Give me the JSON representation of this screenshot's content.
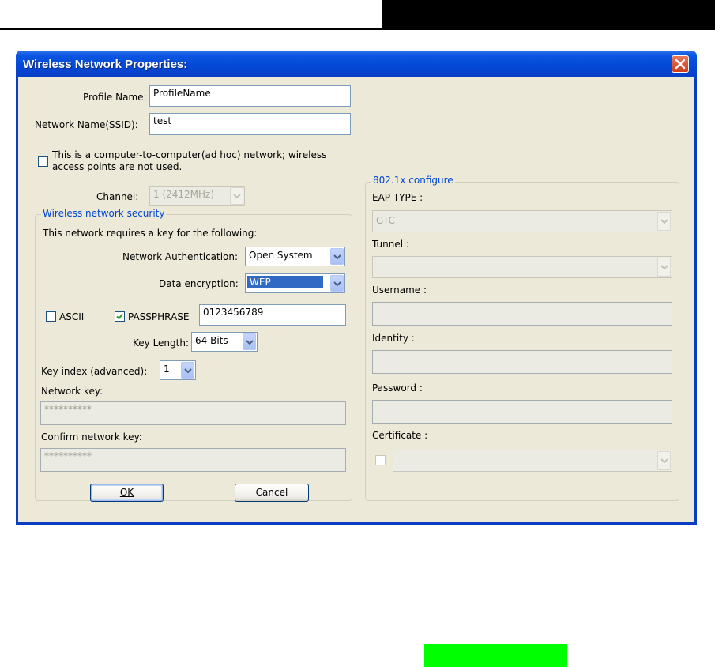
{
  "dialog": {
    "title": "Wireless Network Properties:",
    "profile_name_label": "Profile Name:",
    "profile_name_value": "ProfileName",
    "ssid_label": "Network Name(SSID):",
    "ssid_value": "test",
    "adhoc_label_line1": "This is a computer-to-computer(ad hoc) network; wireless",
    "adhoc_label_line2": "access points are not used.",
    "adhoc_checked": false,
    "channel_label": "Channel:",
    "channel_value": "1 (2412MHz)"
  },
  "security": {
    "group_title": "Wireless network security",
    "requires_key_text": "This network requires a key for the following:",
    "auth_label": "Network Authentication:",
    "auth_value": "Open System",
    "encryption_label": "Data encryption:",
    "encryption_value": "WEP",
    "ascii_label": "ASCII",
    "ascii_checked": false,
    "passphrase_label": "PASSPHRASE",
    "passphrase_checked": true,
    "passphrase_value": "0123456789",
    "key_length_label": "Key Length:",
    "key_length_value": "64 Bits",
    "key_index_label": "Key index (advanced):",
    "key_index_value": "1",
    "network_key_label": "Network key:",
    "network_key_value": "**********",
    "confirm_key_label": "Confirm network key:",
    "confirm_key_value": "**********"
  },
  "dot1x": {
    "group_title": "802.1x configure",
    "eap_type_label": "EAP TYPE :",
    "eap_type_value": "GTC",
    "tunnel_label": "Tunnel :",
    "tunnel_value": "",
    "username_label": "Username :",
    "identity_label": "Identity :",
    "password_label": "Password :",
    "certificate_label": "Certificate :",
    "certificate_value": ""
  },
  "buttons": {
    "ok_label": "OK",
    "cancel_label": "Cancel"
  },
  "colors": {
    "titlebar": "#0348d6",
    "group_title": "#0046d5",
    "dialog_bg": "#ece9d8",
    "highlight": "#316ac5",
    "green_block": "#00ff00"
  },
  "icons": {
    "close": "close-icon",
    "dropdown": "chevron-down-icon",
    "check": "checkmark-icon"
  }
}
